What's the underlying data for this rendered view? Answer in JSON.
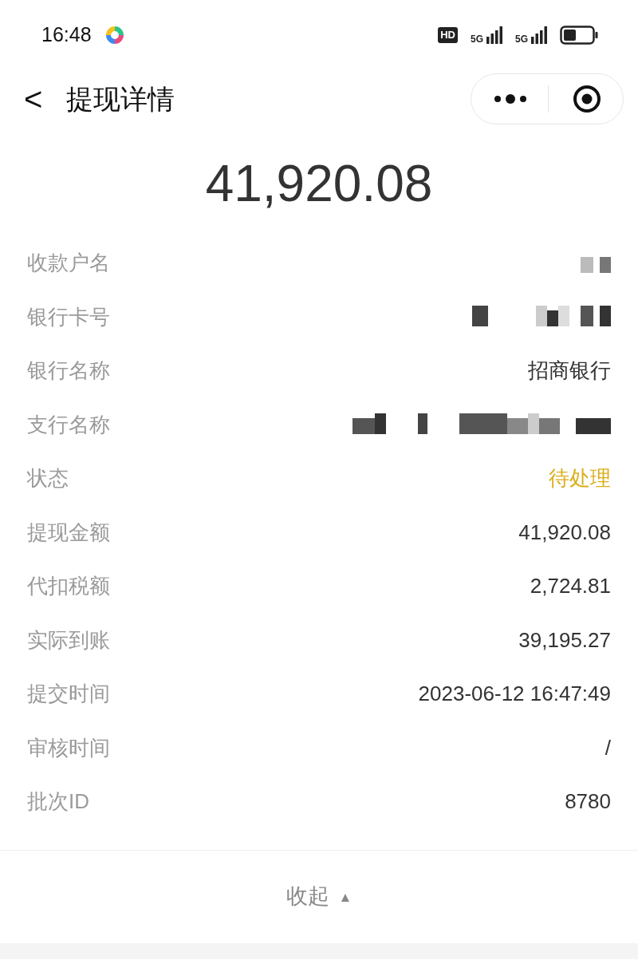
{
  "status_bar": {
    "time": "16:48",
    "hd_badge": "HD",
    "networks": [
      "5G",
      "5G"
    ]
  },
  "header": {
    "back": "<",
    "title": "提现详情"
  },
  "amount": "41,920.08",
  "rows": [
    {
      "label": "收款户名",
      "kind": "redacted"
    },
    {
      "label": "银行卡号",
      "kind": "redacted"
    },
    {
      "label": "银行名称",
      "kind": "text",
      "value": "招商银行"
    },
    {
      "label": "支行名称",
      "kind": "redacted"
    },
    {
      "label": "状态",
      "kind": "status",
      "value": "待处理",
      "color": "#d9ae1b"
    },
    {
      "label": "提现金额",
      "kind": "text",
      "value": "41,920.08"
    },
    {
      "label": "代扣税额",
      "kind": "text",
      "value": "2,724.81"
    },
    {
      "label": "实际到账",
      "kind": "text",
      "value": "39,195.27"
    },
    {
      "label": "提交时间",
      "kind": "text",
      "value": "2023-06-12 16:47:49"
    },
    {
      "label": "审核时间",
      "kind": "text",
      "value": "/"
    },
    {
      "label": "批次ID",
      "kind": "text",
      "value": "8780"
    }
  ],
  "collapse": {
    "label": "收起",
    "arrow": "▲"
  }
}
